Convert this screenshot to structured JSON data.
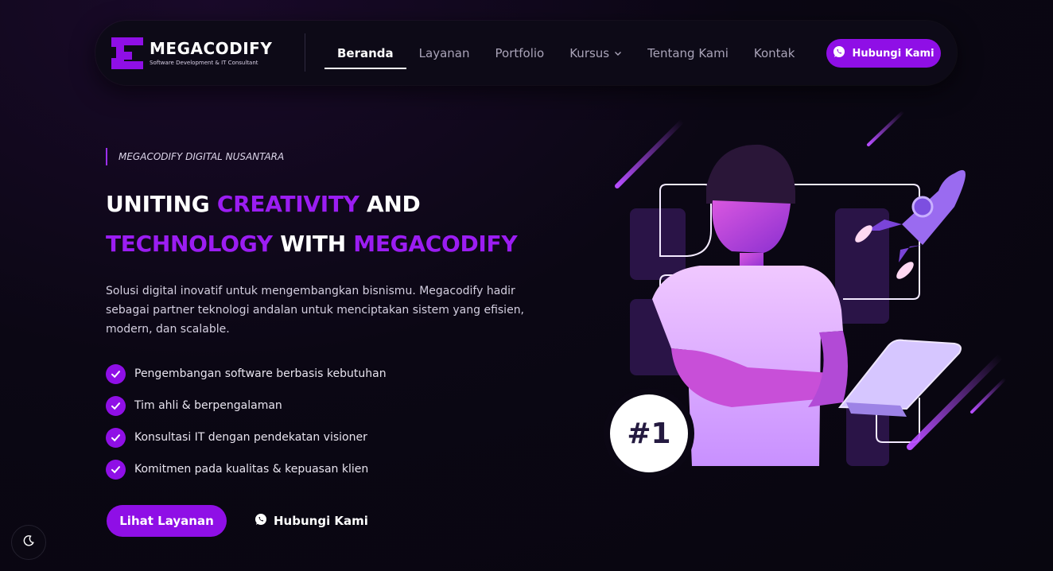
{
  "brand": {
    "name": "MEGACODIFY",
    "tagline": "Software Development & IT Consultant"
  },
  "nav": {
    "links": [
      {
        "label": "Beranda",
        "active": true
      },
      {
        "label": "Layanan",
        "active": false
      },
      {
        "label": "Portfolio",
        "active": false
      },
      {
        "label": "Kursus",
        "active": false,
        "has_dropdown": true
      },
      {
        "label": "Tentang Kami",
        "active": false
      },
      {
        "label": "Kontak",
        "active": false
      }
    ],
    "cta_label": "Hubungi Kami"
  },
  "hero": {
    "kicker": "MEGACODIFY DIGITAL NUSANTARA",
    "headline": {
      "w1": "UNITING",
      "w2": "CREATIVITY",
      "w3": "AND",
      "w4": "TECHNOLOGY",
      "w5": "WITH",
      "w6": "MEGACODIFY"
    },
    "description": "Solusi digital inovatif untuk mengembangkan bisnismu. Megacodify hadir sebagai partner teknologi andalan untuk menciptakan sistem yang efisien, modern, dan scalable.",
    "features": [
      "Pengembangan software berbasis kebutuhan",
      "Tim ahli & berpengalaman",
      "Konsultasi IT dengan pendekatan visioner",
      "Komitmen pada kualitas & kepuasan klien"
    ],
    "primary_button": "Lihat Layanan",
    "secondary_button": "Hubungi Kami",
    "badge": "#1"
  },
  "icons": {
    "whatsapp": "whatsapp-icon",
    "check": "check-icon",
    "moon": "moon-icon",
    "chevron": "chevron-down-icon",
    "rocket": "rocket-icon"
  },
  "colors": {
    "accent": "#8f0fe6",
    "accent_text": "#9b1df2",
    "background": "#0b0714",
    "navbar": "#0d0a17"
  }
}
